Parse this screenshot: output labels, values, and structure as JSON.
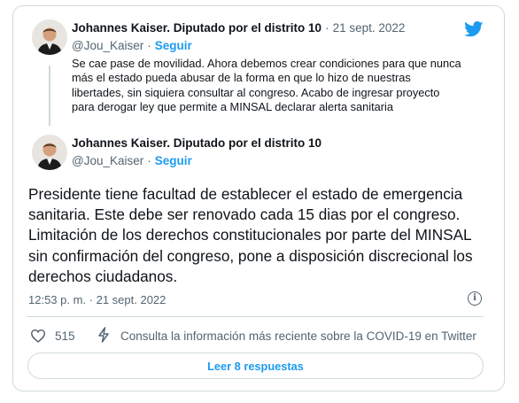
{
  "quoted_tweet": {
    "author_name": "Johannes Kaiser. Diputado por el distrito 10",
    "separator": "·",
    "date": "21 sept. 2022",
    "handle": "@Jou_Kaiser",
    "follow_label": "Seguir",
    "text": "Se cae pase de movilidad. Ahora debemos crear condiciones para que nunca más el estado pueda abusar de la forma en que lo hizo de nuestras libertades, sin siquiera consultar al congreso. Acabo de ingresar proyecto para derogar ley que permite a MINSAL declarar alerta sanitaria"
  },
  "main_tweet": {
    "author_name": "Johannes Kaiser. Diputado por el distrito 10",
    "handle": "@Jou_Kaiser",
    "follow_label": "Seguir",
    "text": "Presidente tiene facultad de establecer el estado de emergencia sanitaria. Este debe ser renovado cada 15 dias por el congreso. Limitación de los derechos constitucionales por parte del MINSAL sin confirmación del congreso, pone a disposición discrecional los derechos ciudadanos.",
    "timestamp": "12:53 p. m. · 21 sept. 2022"
  },
  "actions": {
    "like_count": "515",
    "covid_notice": "Consulta la información más reciente sobre la COVID-19 en Twitter",
    "read_replies_label": "Leer 8 respuestas"
  },
  "icons": {
    "brand": "twitter-bird-icon",
    "info": "info-icon",
    "like": "heart-icon",
    "covid": "lightning-bolt-icon"
  },
  "colors": {
    "accent": "#1d9bf0",
    "text": "#0f1419",
    "secondary": "#536471",
    "border": "#cfd9de"
  }
}
